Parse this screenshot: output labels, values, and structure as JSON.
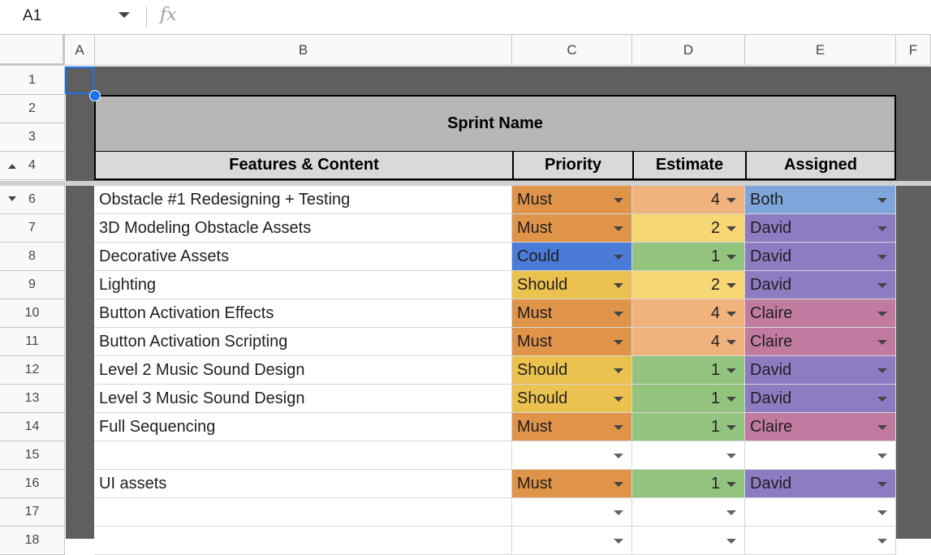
{
  "formula_bar": {
    "cell_ref": "A1",
    "fx": "fx"
  },
  "columns": [
    "A",
    "B",
    "C",
    "D",
    "E",
    "F"
  ],
  "row_numbers": [
    "1",
    "2",
    "3",
    "4",
    "6",
    "7",
    "8",
    "9",
    "10",
    "11",
    "12",
    "13",
    "14",
    "15",
    "16",
    "17",
    "18"
  ],
  "sheet": {
    "title": "Sprint Name",
    "headers": {
      "features": "Features & Content",
      "priority": "Priority",
      "estimate": "Estimate",
      "assigned": "Assigned"
    },
    "rows": [
      {
        "row": "6",
        "feature": "Obstacle #1 Redesigning + Testing",
        "priority": "Must",
        "estimate": "4",
        "assigned": "Both"
      },
      {
        "row": "7",
        "feature": "3D Modeling Obstacle Assets",
        "priority": "Must",
        "estimate": "2",
        "assigned": "David"
      },
      {
        "row": "8",
        "feature": "Decorative Assets",
        "priority": "Could",
        "estimate": "1",
        "assigned": "David"
      },
      {
        "row": "9",
        "feature": "Lighting",
        "priority": "Should",
        "estimate": "2",
        "assigned": "David"
      },
      {
        "row": "10",
        "feature": "Button Activation Effects",
        "priority": "Must",
        "estimate": "4",
        "assigned": "Claire"
      },
      {
        "row": "11",
        "feature": "Button Activation Scripting",
        "priority": "Must",
        "estimate": "4",
        "assigned": "Claire"
      },
      {
        "row": "12",
        "feature": "Level 2 Music Sound Design",
        "priority": "Should",
        "estimate": "1",
        "assigned": "David"
      },
      {
        "row": "13",
        "feature": "Level 3 Music Sound Design",
        "priority": "Should",
        "estimate": "1",
        "assigned": "David"
      },
      {
        "row": "14",
        "feature": "Full Sequencing",
        "priority": "Must",
        "estimate": "1",
        "assigned": "Claire"
      },
      {
        "row": "15",
        "feature": "",
        "priority": "",
        "estimate": "",
        "assigned": ""
      },
      {
        "row": "16",
        "feature": "UI assets",
        "priority": "Must",
        "estimate": "1",
        "assigned": "David"
      },
      {
        "row": "17",
        "feature": "",
        "priority": "",
        "estimate": "",
        "assigned": ""
      },
      {
        "row": "18",
        "feature": "",
        "priority": "",
        "estimate": "",
        "assigned": ""
      }
    ]
  },
  "colors": {
    "priority": {
      "Must": "#e0944a",
      "Should": "#ebc24f",
      "Could": "#4a7bd8"
    },
    "estimate": {
      "4": "#f0b37e",
      "2": "#f7d774",
      "1": "#93c47d"
    },
    "assigned": {
      "Both": "#7ea6db",
      "David": "#8e7cc3",
      "Claire": "#c27ba0"
    },
    "grid_dark": "#5f5f5f",
    "title_fill": "#b7b7b7",
    "header_fill": "#d9d9d9",
    "selection": "#1a73e8"
  },
  "icons": {
    "name_box_dropdown": "chevron-down-icon",
    "formula": "fx-icon",
    "cell_dropdown": "dropdown-arrow-icon",
    "row_group_toggle": "group-toggle-icon"
  }
}
